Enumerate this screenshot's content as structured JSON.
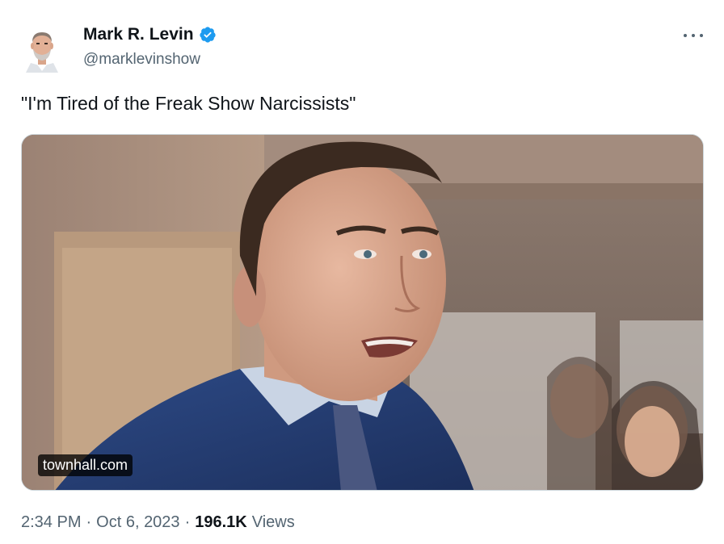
{
  "author": {
    "name": "Mark R. Levin",
    "handle": "@marklevinshow",
    "verified": true
  },
  "tweet": {
    "text": "\"I'm Tired of the Freak Show Narcissists\""
  },
  "media": {
    "source_label": "townhall.com"
  },
  "footer": {
    "time": "2:34 PM",
    "separator": "·",
    "date": "Oct 6, 2023",
    "views_count": "196.1K",
    "views_label": "Views"
  },
  "icons": {
    "verified": "verified-badge-icon",
    "more": "more-options-icon"
  },
  "colors": {
    "verified_blue": "#1d9bf0",
    "secondary_text": "#536471",
    "primary_text": "#0f1419"
  }
}
